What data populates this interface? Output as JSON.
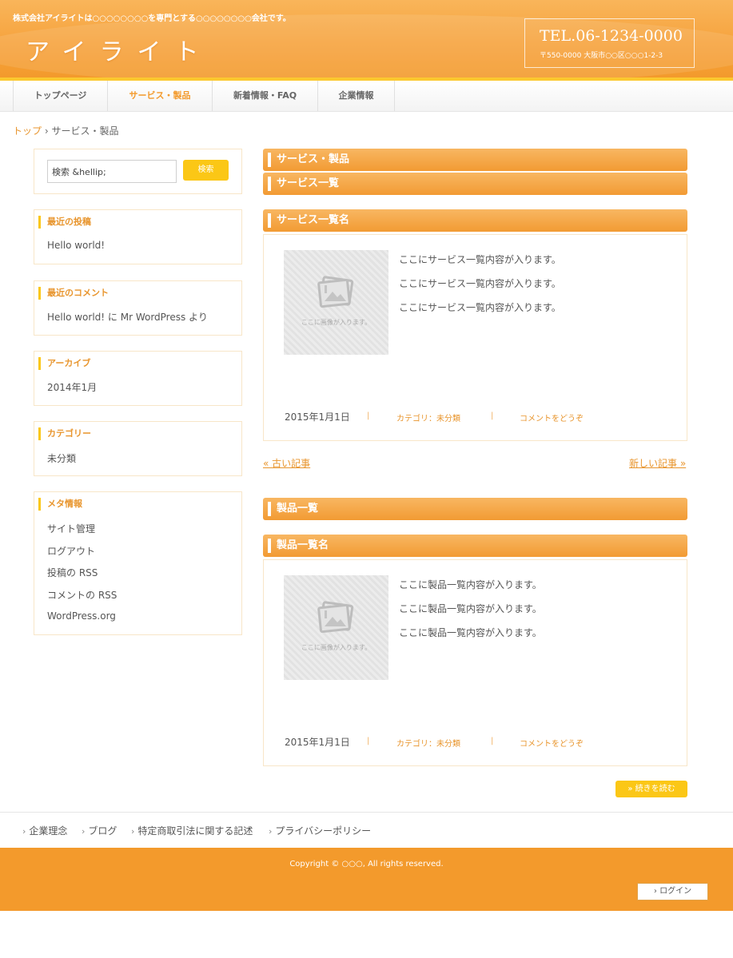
{
  "header": {
    "tagline": "株式会社アイライトは○○○○○○○○を専門とする○○○○○○○○会社です。",
    "logo": "アイライト",
    "tel": "TEL.06-1234-0000",
    "address": "〒550-0000 大阪市○○区○○○1-2-3"
  },
  "nav": {
    "items": [
      {
        "label": "トップページ"
      },
      {
        "label": "サービス・製品"
      },
      {
        "label": "新着情報・FAQ"
      },
      {
        "label": "企業情報"
      }
    ],
    "active_index": 1
  },
  "breadcrumb": {
    "home": "トップ",
    "separator": "›",
    "current": "サービス・製品"
  },
  "sidebar": {
    "search": {
      "value": "検索 &hellip;",
      "button": "検索"
    },
    "recent_posts": {
      "title": "最近の投稿",
      "items": [
        "Hello world!"
      ]
    },
    "recent_comments": {
      "title": "最近のコメント",
      "items": [
        "Hello world! に Mr WordPress より"
      ]
    },
    "archives": {
      "title": "アーカイブ",
      "items": [
        "2014年1月"
      ]
    },
    "categories": {
      "title": "カテゴリー",
      "items": [
        "未分類"
      ]
    },
    "meta": {
      "title": "メタ情報",
      "items": [
        "サイト管理",
        "ログアウト",
        "投稿の RSS",
        "コメントの RSS",
        "WordPress.org"
      ]
    }
  },
  "main": {
    "page_title": "サービス・製品",
    "service_section": "サービス一覧",
    "service_post": {
      "title": "サービス一覧名",
      "thumb_caption": "ここに画像が入ります。",
      "lines": [
        "ここにサービス一覧内容が入ります。",
        "ここにサービス一覧内容が入ります。",
        "ここにサービス一覧内容が入ります。"
      ],
      "date": "2015年1月1日",
      "separator": "|",
      "category": "カテゴリ：未分類",
      "comment": "コメントをどうぞ"
    },
    "pager": {
      "older": "« 古い記事",
      "newer": "新しい記事 »"
    },
    "product_section": "製品一覧",
    "product_post": {
      "title": "製品一覧名",
      "thumb_caption": "ここに画像が入ります。",
      "lines": [
        "ここに製品一覧内容が入ります。",
        "ここに製品一覧内容が入ります。",
        "ここに製品一覧内容が入ります。"
      ],
      "date": "2015年1月1日",
      "separator": "|",
      "category": "カテゴリ：未分類",
      "comment": "コメントをどうぞ"
    },
    "more_button": "» 続きを読む"
  },
  "footer": {
    "arrow": "›",
    "links": [
      "企業理念",
      "ブログ",
      "特定商取引法に関する記述",
      "プライバシーポリシー"
    ],
    "copyright": "Copyright © ○○○, All rights reserved.",
    "login": "› ログイン"
  },
  "colors": {
    "accent": "#f39a2c",
    "highlight": "#fbc716",
    "link": "#e8952d"
  }
}
